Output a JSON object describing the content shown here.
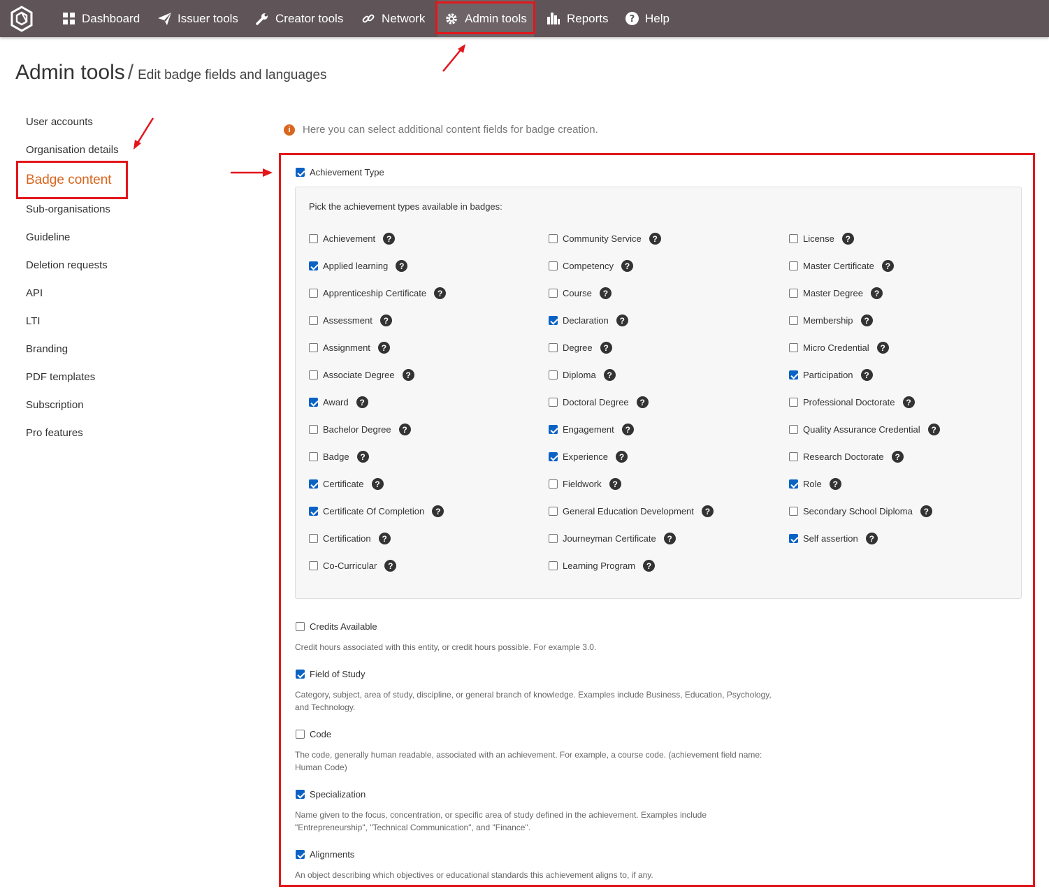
{
  "nav": {
    "items": [
      {
        "id": "dashboard",
        "label": "Dashboard",
        "icon": "grid-icon"
      },
      {
        "id": "issuer",
        "label": "Issuer tools",
        "icon": "paper-plane-icon"
      },
      {
        "id": "creator",
        "label": "Creator tools",
        "icon": "wrench-icon"
      },
      {
        "id": "network",
        "label": "Network",
        "icon": "link-icon"
      },
      {
        "id": "admin",
        "label": "Admin tools",
        "icon": "gear-icon"
      },
      {
        "id": "reports",
        "label": "Reports",
        "icon": "bar-chart-icon"
      },
      {
        "id": "help",
        "label": "Help",
        "icon": "question-circle-icon"
      }
    ],
    "active": "Admin tools"
  },
  "page": {
    "title": "Admin tools",
    "separator": "/",
    "subtitle": "Edit badge fields and languages"
  },
  "sidebar": {
    "items": [
      "User accounts",
      "Organisation details",
      "Badge content",
      "Sub-organisations",
      "Guideline",
      "Deletion requests",
      "API",
      "LTI",
      "Branding",
      "PDF templates",
      "Subscription",
      "Pro features"
    ],
    "active": "Badge content"
  },
  "info": {
    "icon": "info-circle-icon",
    "text": "Here you can select additional content fields for badge creation."
  },
  "achievement_type": {
    "label": "Achievement Type",
    "checked": true,
    "prompt": "Pick the achievement types available in badges:",
    "columns": [
      [
        {
          "label": "Achievement",
          "checked": false
        },
        {
          "label": "Applied learning",
          "checked": true
        },
        {
          "label": "Apprenticeship Certificate",
          "checked": false
        },
        {
          "label": "Assessment",
          "checked": false
        },
        {
          "label": "Assignment",
          "checked": false
        },
        {
          "label": "Associate Degree",
          "checked": false
        },
        {
          "label": "Award",
          "checked": true
        },
        {
          "label": "Bachelor Degree",
          "checked": false
        },
        {
          "label": "Badge",
          "checked": false
        },
        {
          "label": "Certificate",
          "checked": true
        },
        {
          "label": "Certificate Of Completion",
          "checked": true
        },
        {
          "label": "Certification",
          "checked": false
        },
        {
          "label": "Co-Curricular",
          "checked": false
        }
      ],
      [
        {
          "label": "Community Service",
          "checked": false
        },
        {
          "label": "Competency",
          "checked": false
        },
        {
          "label": "Course",
          "checked": false
        },
        {
          "label": "Declaration",
          "checked": true
        },
        {
          "label": "Degree",
          "checked": false
        },
        {
          "label": "Diploma",
          "checked": false
        },
        {
          "label": "Doctoral Degree",
          "checked": false
        },
        {
          "label": "Engagement",
          "checked": true
        },
        {
          "label": "Experience",
          "checked": true
        },
        {
          "label": "Fieldwork",
          "checked": false
        },
        {
          "label": "General Education Development",
          "checked": false
        },
        {
          "label": "Journeyman Certificate",
          "checked": false
        },
        {
          "label": "Learning Program",
          "checked": false
        }
      ],
      [
        {
          "label": "License",
          "checked": false
        },
        {
          "label": "Master Certificate",
          "checked": false
        },
        {
          "label": "Master Degree",
          "checked": false
        },
        {
          "label": "Membership",
          "checked": false
        },
        {
          "label": "Micro Credential",
          "checked": false
        },
        {
          "label": "Participation",
          "checked": true
        },
        {
          "label": "Professional Doctorate",
          "checked": false
        },
        {
          "label": "Quality Assurance Credential",
          "checked": false
        },
        {
          "label": "Research Doctorate",
          "checked": false
        },
        {
          "label": "Role",
          "checked": true
        },
        {
          "label": "Secondary School Diploma",
          "checked": false
        },
        {
          "label": "Self assertion",
          "checked": true
        }
      ]
    ]
  },
  "fields": [
    {
      "label": "Credits Available",
      "checked": false,
      "desc": "Credit hours associated with this entity, or credit hours possible. For example 3.0."
    },
    {
      "label": "Field of Study",
      "checked": true,
      "desc": "Category, subject, area of study, discipline, or general branch of knowledge. Examples include Business, Education, Psychology, and Technology."
    },
    {
      "label": "Code",
      "checked": false,
      "desc": "The code, generally human readable, associated with an achievement. For example, a course code. (achievement field name: Human Code)"
    },
    {
      "label": "Specialization",
      "checked": true,
      "desc": "Name given to the focus, concentration, or specific area of study defined in the achievement. Examples include \"Entrepreneurship\", \"Technical Communication\", and \"Finance\"."
    },
    {
      "label": "Alignments",
      "checked": true,
      "desc": "An object describing which objectives or educational standards this achievement aligns to, if any."
    }
  ],
  "colors": {
    "nav_bg": "#5f5558",
    "highlight": "#e3161c",
    "accent_orange": "#d9661f",
    "checkbox_blue": "#0b62c5"
  }
}
